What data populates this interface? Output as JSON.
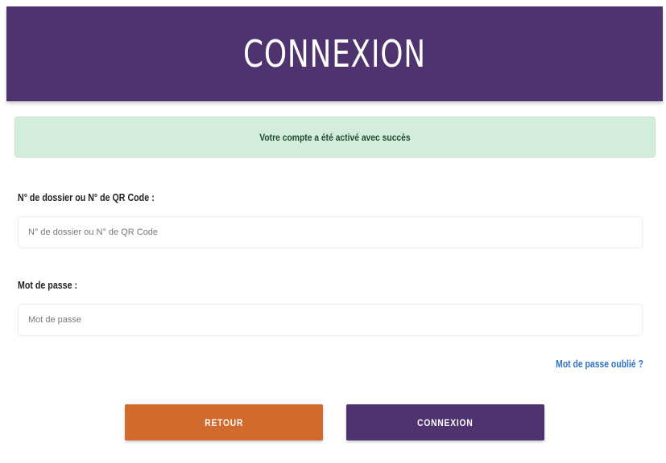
{
  "header": {
    "title": "CONNEXION"
  },
  "alert": {
    "message": "Votre compte a été activé avec succès"
  },
  "form": {
    "dossier_label": "N° de dossier ou N° de QR Code :",
    "dossier_placeholder": "N° de dossier ou N° de QR Code",
    "password_label": "Mot de passe :",
    "password_placeholder": "Mot de passe",
    "forgot_link": "Mot de passe oublié ?"
  },
  "buttons": {
    "back": "RETOUR",
    "login": "CONNEXION"
  },
  "colors": {
    "brand_purple": "#4f336f",
    "button_orange": "#d2692d",
    "alert_bg": "#d4ecdc",
    "link_blue": "#2d73c5"
  }
}
